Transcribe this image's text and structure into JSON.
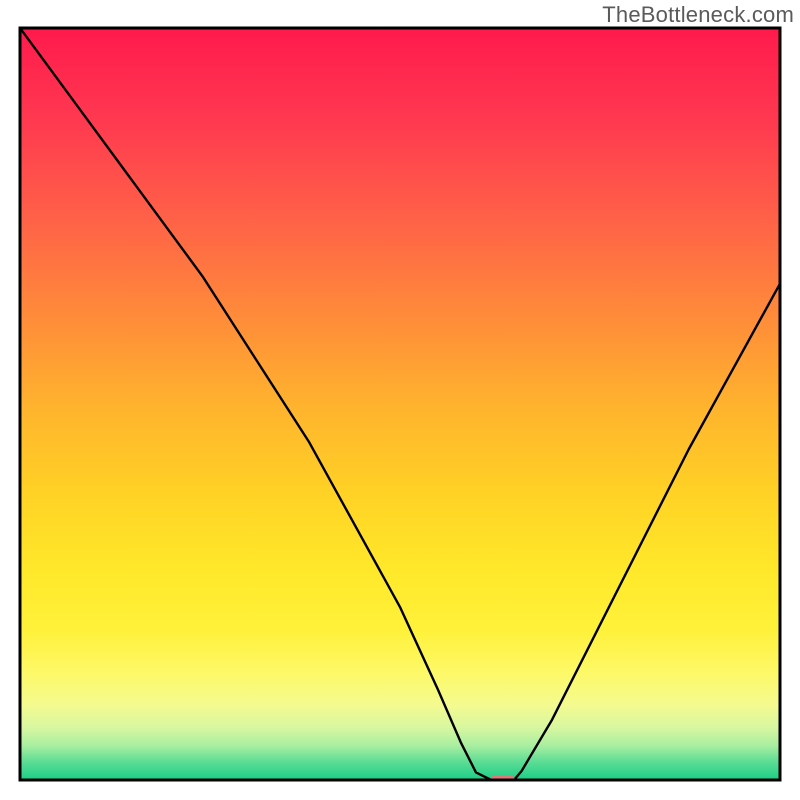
{
  "watermark": "TheBottleneck.com",
  "chart_data": {
    "type": "line",
    "title": "",
    "xlabel": "",
    "ylabel": "",
    "xlim": [
      0,
      100
    ],
    "ylim": [
      0,
      100
    ],
    "grid": false,
    "legend": false,
    "axes_visible": false,
    "series": [
      {
        "name": "bottleneck-curve",
        "x": [
          0,
          8,
          16,
          24,
          31,
          38,
          44,
          50,
          55,
          58,
          60,
          62,
          63.5,
          65,
          66,
          70,
          76,
          82,
          88,
          94,
          100
        ],
        "y": [
          100,
          89,
          78,
          67,
          56,
          45,
          34,
          23,
          12,
          5,
          1,
          0,
          0,
          0,
          1.2,
          8,
          20,
          32,
          44,
          55,
          66
        ]
      }
    ],
    "marker": {
      "name": "optimal-point",
      "x": 63.5,
      "y": 0,
      "width_data_units": 3.2,
      "height_data_units": 1.2,
      "fill": "#e07878"
    },
    "background": {
      "type": "vertical-gradient",
      "stops": [
        {
          "pos": 0.0,
          "color": "#ff1a4d"
        },
        {
          "pos": 0.12,
          "color": "#ff3850"
        },
        {
          "pos": 0.25,
          "color": "#ff6048"
        },
        {
          "pos": 0.38,
          "color": "#ff8a3a"
        },
        {
          "pos": 0.5,
          "color": "#ffb22e"
        },
        {
          "pos": 0.62,
          "color": "#ffd225"
        },
        {
          "pos": 0.72,
          "color": "#ffe82a"
        },
        {
          "pos": 0.8,
          "color": "#fff13a"
        },
        {
          "pos": 0.86,
          "color": "#fdf96a"
        },
        {
          "pos": 0.9,
          "color": "#f4fa8f"
        },
        {
          "pos": 0.93,
          "color": "#d8f7a0"
        },
        {
          "pos": 0.955,
          "color": "#a7eea0"
        },
        {
          "pos": 0.975,
          "color": "#5fdd95"
        },
        {
          "pos": 1.0,
          "color": "#1bce86"
        }
      ]
    },
    "frame_color": "#000000",
    "frame_width": 3,
    "line_color": "#000000",
    "line_width": 2.4
  }
}
